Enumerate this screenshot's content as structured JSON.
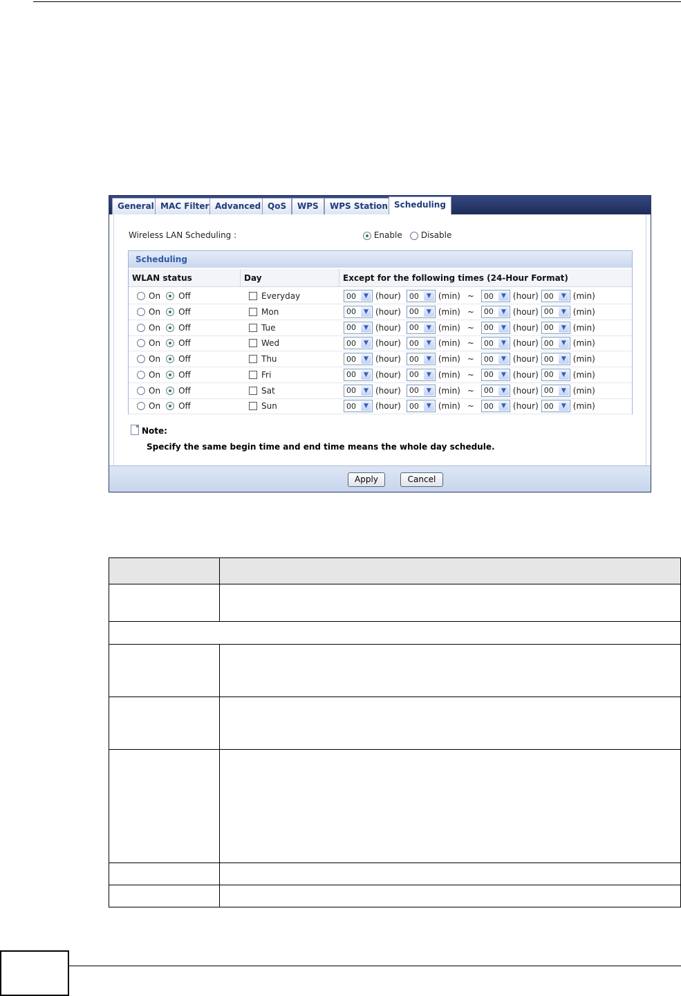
{
  "tabs": [
    "General",
    "MAC Filter",
    "Advanced",
    "QoS",
    "WPS",
    "WPS Station",
    "Scheduling"
  ],
  "active_tab": "Scheduling",
  "wireless_lan_scheduling": {
    "label": "Wireless LAN Scheduling :",
    "enable_label": "Enable",
    "disable_label": "Disable",
    "selected": "Enable"
  },
  "scheduling_section": {
    "title": "Scheduling",
    "columns": [
      "WLAN status",
      "Day",
      "Except for the following times (24-Hour Format)"
    ],
    "on_label": "On",
    "off_label": "Off",
    "hour_label": "(hour)",
    "min_label": "(min)",
    "tilde": "~",
    "rows": [
      {
        "day": "Everyday",
        "status": "Off",
        "start_hour": "00",
        "start_min": "00",
        "end_hour": "00",
        "end_min": "00"
      },
      {
        "day": "Mon",
        "status": "Off",
        "start_hour": "00",
        "start_min": "00",
        "end_hour": "00",
        "end_min": "00"
      },
      {
        "day": "Tue",
        "status": "Off",
        "start_hour": "00",
        "start_min": "00",
        "end_hour": "00",
        "end_min": "00"
      },
      {
        "day": "Wed",
        "status": "Off",
        "start_hour": "00",
        "start_min": "00",
        "end_hour": "00",
        "end_min": "00"
      },
      {
        "day": "Thu",
        "status": "Off",
        "start_hour": "00",
        "start_min": "00",
        "end_hour": "00",
        "end_min": "00"
      },
      {
        "day": "Fri",
        "status": "Off",
        "start_hour": "00",
        "start_min": "00",
        "end_hour": "00",
        "end_min": "00"
      },
      {
        "day": "Sat",
        "status": "Off",
        "start_hour": "00",
        "start_min": "00",
        "end_hour": "00",
        "end_min": "00"
      },
      {
        "day": "Sun",
        "status": "Off",
        "start_hour": "00",
        "start_min": "00",
        "end_hour": "00",
        "end_min": "00"
      }
    ]
  },
  "note": {
    "title": "Note:",
    "text": "Specify the same begin time and end time means the whole day schedule."
  },
  "buttons": {
    "apply": "Apply",
    "cancel": "Cancel"
  }
}
